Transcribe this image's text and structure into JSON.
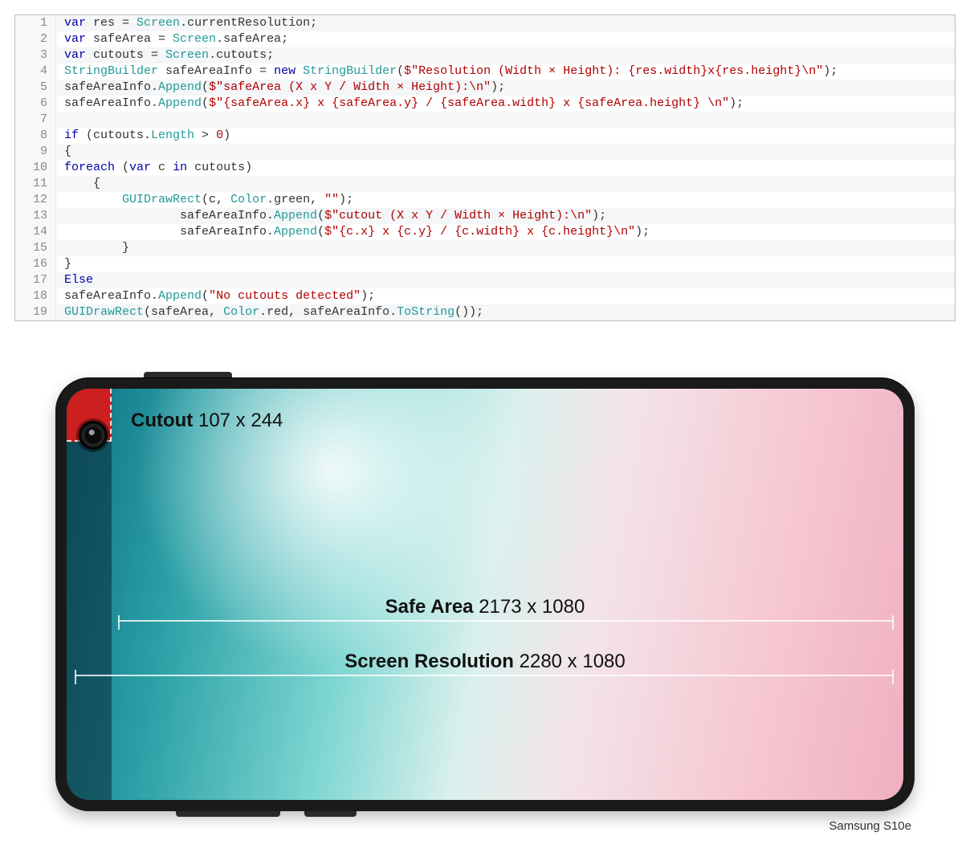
{
  "code": {
    "lines": [
      [
        {
          "c": "kw",
          "t": "var"
        },
        {
          "c": "plain",
          "t": " res "
        },
        {
          "c": "plain",
          "t": "= "
        },
        {
          "c": "type",
          "t": "Screen"
        },
        {
          "c": "plain",
          "t": ".currentResolution;"
        }
      ],
      [
        {
          "c": "kw",
          "t": "var"
        },
        {
          "c": "plain",
          "t": " safeArea "
        },
        {
          "c": "plain",
          "t": "= "
        },
        {
          "c": "type",
          "t": "Screen"
        },
        {
          "c": "plain",
          "t": ".safeArea;"
        }
      ],
      [
        {
          "c": "kw",
          "t": "var"
        },
        {
          "c": "plain",
          "t": " cutouts "
        },
        {
          "c": "plain",
          "t": "= "
        },
        {
          "c": "type",
          "t": "Screen"
        },
        {
          "c": "plain",
          "t": ".cutouts;"
        }
      ],
      [
        {
          "c": "type",
          "t": "StringBuilder"
        },
        {
          "c": "plain",
          "t": " safeAreaInfo "
        },
        {
          "c": "plain",
          "t": "= "
        },
        {
          "c": "kw",
          "t": "new"
        },
        {
          "c": "plain",
          "t": " "
        },
        {
          "c": "type",
          "t": "StringBuilder"
        },
        {
          "c": "plain",
          "t": "("
        },
        {
          "c": "str",
          "t": "$\"Resolution (Width × Height): {res.width}x{res.height}\\n\""
        },
        {
          "c": "plain",
          "t": ");"
        }
      ],
      [
        {
          "c": "plain",
          "t": "safeAreaInfo."
        },
        {
          "c": "id",
          "t": "Append"
        },
        {
          "c": "plain",
          "t": "("
        },
        {
          "c": "str",
          "t": "$\"safeArea (X x Y / Width × Height):\\n\""
        },
        {
          "c": "plain",
          "t": ");"
        }
      ],
      [
        {
          "c": "plain",
          "t": "safeAreaInfo."
        },
        {
          "c": "id",
          "t": "Append"
        },
        {
          "c": "plain",
          "t": "("
        },
        {
          "c": "str",
          "t": "$\"{safeArea.x} x {safeArea.y} / {safeArea.width} x {safeArea.height} \\n\""
        },
        {
          "c": "plain",
          "t": ");"
        }
      ],
      [
        {
          "c": "plain",
          "t": ""
        }
      ],
      [
        {
          "c": "kw",
          "t": "if"
        },
        {
          "c": "plain",
          "t": " (cutouts."
        },
        {
          "c": "id",
          "t": "Length"
        },
        {
          "c": "plain",
          "t": " > "
        },
        {
          "c": "num",
          "t": "0"
        },
        {
          "c": "plain",
          "t": ")"
        }
      ],
      [
        {
          "c": "plain",
          "t": "{"
        }
      ],
      [
        {
          "c": "kw",
          "t": "foreach"
        },
        {
          "c": "plain",
          "t": " ("
        },
        {
          "c": "kw",
          "t": "var"
        },
        {
          "c": "plain",
          "t": " c "
        },
        {
          "c": "kw",
          "t": "in"
        },
        {
          "c": "plain",
          "t": " cutouts)"
        }
      ],
      [
        {
          "c": "plain",
          "t": "    {"
        }
      ],
      [
        {
          "c": "plain",
          "t": "        "
        },
        {
          "c": "id",
          "t": "GUIDrawRect"
        },
        {
          "c": "plain",
          "t": "(c, "
        },
        {
          "c": "type",
          "t": "Color"
        },
        {
          "c": "plain",
          "t": ".green, "
        },
        {
          "c": "str",
          "t": "\"\""
        },
        {
          "c": "plain",
          "t": ");"
        }
      ],
      [
        {
          "c": "plain",
          "t": "                safeAreaInfo."
        },
        {
          "c": "id",
          "t": "Append"
        },
        {
          "c": "plain",
          "t": "("
        },
        {
          "c": "str",
          "t": "$\"cutout (X x Y / Width × Height):\\n\""
        },
        {
          "c": "plain",
          "t": ");"
        }
      ],
      [
        {
          "c": "plain",
          "t": "                safeAreaInfo."
        },
        {
          "c": "id",
          "t": "Append"
        },
        {
          "c": "plain",
          "t": "("
        },
        {
          "c": "str",
          "t": "$\"{c.x} x {c.y} / {c.width} x {c.height}\\n\""
        },
        {
          "c": "plain",
          "t": ");"
        }
      ],
      [
        {
          "c": "plain",
          "t": "        }"
        }
      ],
      [
        {
          "c": "plain",
          "t": "}"
        }
      ],
      [
        {
          "c": "kw",
          "t": "Else"
        }
      ],
      [
        {
          "c": "plain",
          "t": "safeAreaInfo."
        },
        {
          "c": "id",
          "t": "Append"
        },
        {
          "c": "plain",
          "t": "("
        },
        {
          "c": "str",
          "t": "\"No cutouts detected\""
        },
        {
          "c": "plain",
          "t": ");"
        }
      ],
      [
        {
          "c": "id",
          "t": "GUIDrawRect"
        },
        {
          "c": "plain",
          "t": "(safeArea, "
        },
        {
          "c": "type",
          "t": "Color"
        },
        {
          "c": "plain",
          "t": ".red, safeAreaInfo."
        },
        {
          "c": "id",
          "t": "ToString"
        },
        {
          "c": "plain",
          "t": "());"
        }
      ]
    ]
  },
  "phone": {
    "cutout": {
      "label": "Cutout",
      "value": "107 x 244"
    },
    "safeArea": {
      "label": "Safe Area",
      "value": "2173 x 1080"
    },
    "resolution": {
      "label": "Screen Resolution",
      "value": "2280 x 1080"
    },
    "caption": "Samsung S10e"
  }
}
